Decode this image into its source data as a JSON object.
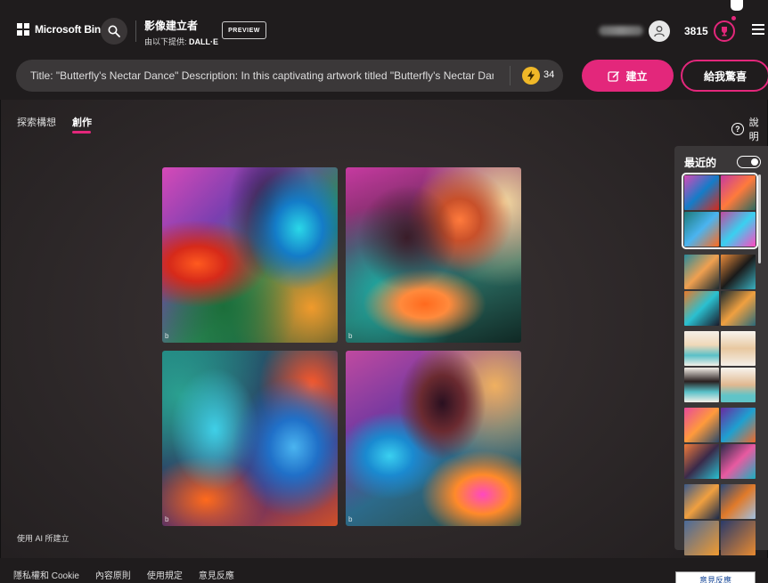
{
  "header": {
    "brand": "Microsoft Bing",
    "product_name": "影像建立者",
    "powered_by_prefix": "由以下提供:",
    "powered_by_model": "DALL·E",
    "preview_badge": "PREVIEW",
    "points": "3815"
  },
  "prompt": {
    "text": "Title: \"Butterfly's Nectar Dance\"  Description: In this captivating artwork titled \"Butterfly's Nectar Dance\" the",
    "boosts": "34",
    "create_label": "建立",
    "surprise_label": "給我驚喜"
  },
  "tabs": {
    "explore": "探索構想",
    "create": "創作"
  },
  "help_label": "說明",
  "results": {
    "watermark": "b",
    "made_with_ai": "使用 AI 所建立"
  },
  "recent": {
    "title": "最近的"
  },
  "footer": {
    "links": [
      "隱私權和 Cookie",
      "內容原則",
      "使用規定",
      "意見反應"
    ],
    "feedback_button": "意見反應"
  },
  "colors": {
    "accent": "#e3277b",
    "header_bg": "#1f1c1d",
    "boost": "#f0b828"
  }
}
